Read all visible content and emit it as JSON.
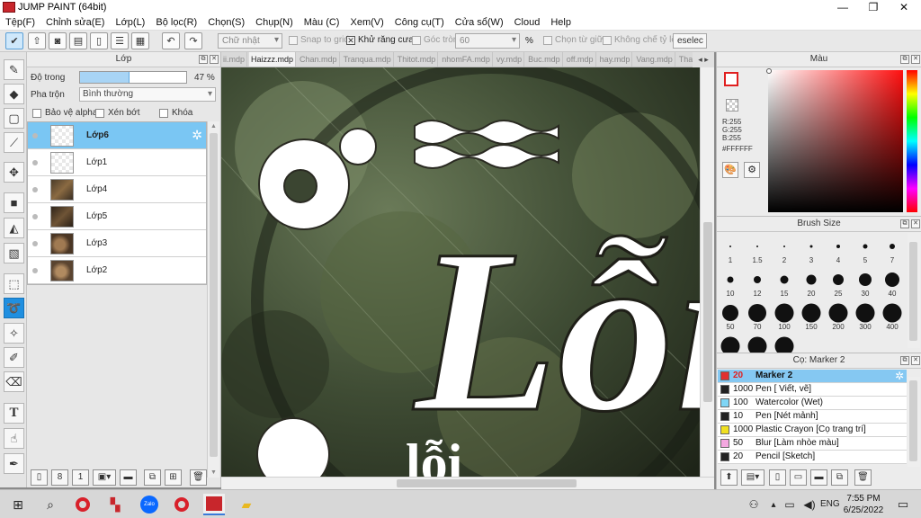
{
  "app": {
    "title": "JUMP PAINT (64bit)"
  },
  "window_controls": {
    "minimize": "—",
    "maximize": "❐",
    "close": "✕"
  },
  "menu": [
    "Tệp(F)",
    "Chỉnh sửa(E)",
    "Lớp(L)",
    "Bộ lọc(R)",
    "Chọn(S)",
    "Chụp(N)",
    "Màu (C)",
    "Xem(V)",
    "Công cụ(T)",
    "Cửa sổ(W)",
    "Cloud",
    "Help"
  ],
  "toolbar": {
    "shape_select": "Chữ nhật",
    "snap_to_grid": "Snap to grid",
    "antialias": "Khử răng cưa",
    "round_corner": "Góc tròn",
    "round_value": "60",
    "percent": "%",
    "select_center": "Chọn từ giữa",
    "lock_ratio": "Không chế tỷ lệ",
    "deselect": "eselec"
  },
  "layer_panel": {
    "title": "Lớp",
    "opacity_label": "Độ trong",
    "opacity_value": "47 %",
    "opacity_fraction": 0.47,
    "blend_label": "Pha trộn",
    "blend_value": "Bình thường",
    "protect_alpha": "Bảo vệ alpha",
    "clip": "Xén bớt",
    "lock": "Khóa",
    "layers": [
      {
        "name": "Lớp6",
        "selected": true
      },
      {
        "name": "Lớp1",
        "selected": false
      },
      {
        "name": "Lớp4",
        "selected": false
      },
      {
        "name": "Lớp5",
        "selected": false
      },
      {
        "name": "Lớp3",
        "selected": false
      },
      {
        "name": "Lớp2",
        "selected": false
      }
    ]
  },
  "doc_tabs": [
    "ii.mdp",
    "Haizzz.mdp",
    "Chan.mdp",
    "Tranqua.mdp",
    "Thitot.mdp",
    "nhomFA.mdp",
    "vy.mdp",
    "Buc.mdp",
    "off.mdp",
    "hay.mdp",
    "Vang.mdp",
    "Thao.mdp"
  ],
  "active_tab": "Haizzz.mdp",
  "color_panel": {
    "title": "Màu",
    "r": "R:255",
    "g": "G:255",
    "b": "B:255",
    "hex": "#FFFFFF"
  },
  "brush_panel": {
    "title": "Brush Size",
    "sizes": [
      "1",
      "1.5",
      "2",
      "3",
      "4",
      "5",
      "7",
      "10",
      "12",
      "15",
      "20",
      "25",
      "30",
      "40",
      "50",
      "70",
      "100",
      "150",
      "200",
      "300",
      "400",
      "",
      "",
      ""
    ]
  },
  "marker_panel": {
    "title": "Cọ: Marker 2",
    "items": [
      {
        "size": "20",
        "name": "Marker 2",
        "color": "#e03030",
        "selected": true
      },
      {
        "size": "1000",
        "name": "Pen [ Viết, vẽ]",
        "color": "#222222",
        "selected": false
      },
      {
        "size": "100",
        "name": "Watercolor (Wet)",
        "color": "#7fd6f6",
        "selected": false
      },
      {
        "size": "10",
        "name": "Pen [Nét mảnh]",
        "color": "#222222",
        "selected": false
      },
      {
        "size": "1000",
        "name": "Plastic Crayon [Cọ trang trí]",
        "color": "#f0e020",
        "selected": false
      },
      {
        "size": "50",
        "name": "Blur [Làm nhòe màu]",
        "color": "#f4a8e0",
        "selected": false
      },
      {
        "size": "20",
        "name": "Pencil [Sketch]",
        "color": "#222222",
        "selected": false
      }
    ]
  },
  "taskbar": {
    "time": "7:55 PM",
    "date": "6/25/2022",
    "lang": "ENG",
    "zalo": "Zalo"
  },
  "canvas_text": {
    "main": "Lỗi",
    "small": "lỗi"
  }
}
